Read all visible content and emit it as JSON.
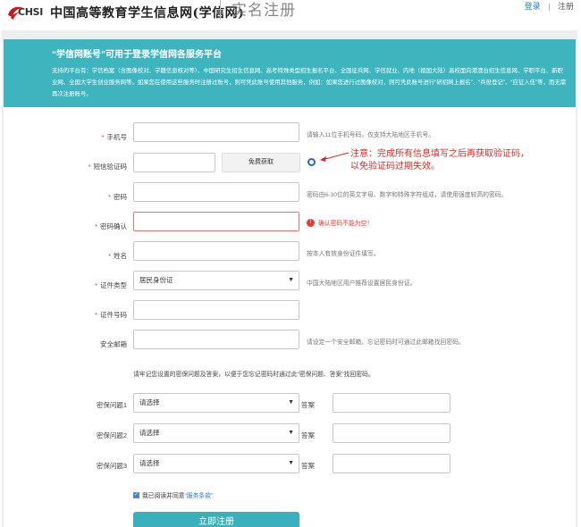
{
  "header": {
    "logo_text": "CHSI",
    "site_name": "中国高等教育学生信息网(学信网)",
    "page_title": "实名注册",
    "login_label": "登录",
    "register_label": "注册",
    "brand_color": "#c8161d"
  },
  "banner": {
    "title": "“学信网账号”可用于登录学信网各服务平台",
    "text": "支持的平台有：学信档案（含图像校对、学籍信息核对等）、中国研究生招生信息网、高考特殊类型招生报名平台、全国征兵网、学信就业、内地（祖国大陆）高校面向港澳台招生信息网、学职平台、新职业网、全国大学生创业服务网等。如果您在使用这些服务时注册过账号，则可凭此账号使用其他服务，例如：如果您进行过图像校对，则可凭此账号进行“研招网上报名”、“兵役登记”、“应征入伍”等，而无需再次注册账号。",
    "color": "#3eb4bf"
  },
  "form": {
    "phone": {
      "label": "手机号",
      "value": "",
      "hint": "请输入11位手机号码，仅支持大陆地区手机号。"
    },
    "sms_code": {
      "label": "短信验证码",
      "value": "",
      "button": "免费获取"
    },
    "note": {
      "line1": "注意：完成所有信息填写之后再获取验证码，",
      "line2": "以免验证码过期失效。"
    },
    "password": {
      "label": "密码",
      "value": "",
      "hint": "密码由6-30位的英文字母、数字和特殊字符组成，请使用强度较高的密码。"
    },
    "password_confirm": {
      "label": "密码确认",
      "value": "",
      "error": "确认密码不能为空！"
    },
    "name": {
      "label": "姓名",
      "value": "",
      "hint": "按本人有效身份证件填写。"
    },
    "id_type": {
      "label": "证件类型",
      "value": "居民身份证",
      "hint": "中国大陆地区用户推荐设置居民身份证。"
    },
    "id_number": {
      "label": "证件号码",
      "value": ""
    },
    "email": {
      "label": "安全邮箱",
      "value": "",
      "hint": "请设定一个安全邮箱，忘记密码时可通过此邮箱找回密码。"
    },
    "security_note": "请牢记您设置的密保问题及答案，以便于您忘记密码时通过此“密保问题、答案”找回密码。",
    "questions": [
      {
        "label": "密保问题1",
        "value": "请选择",
        "answer_label": "答案",
        "answer": ""
      },
      {
        "label": "密保问题2",
        "value": "请选择",
        "answer_label": "答案",
        "answer": ""
      },
      {
        "label": "密保问题3",
        "value": "请选择",
        "answer_label": "答案",
        "answer": ""
      }
    ],
    "agree_text": "我已阅读并同意",
    "agree_link": "“服务条款”",
    "submit_label": "立即注册"
  }
}
